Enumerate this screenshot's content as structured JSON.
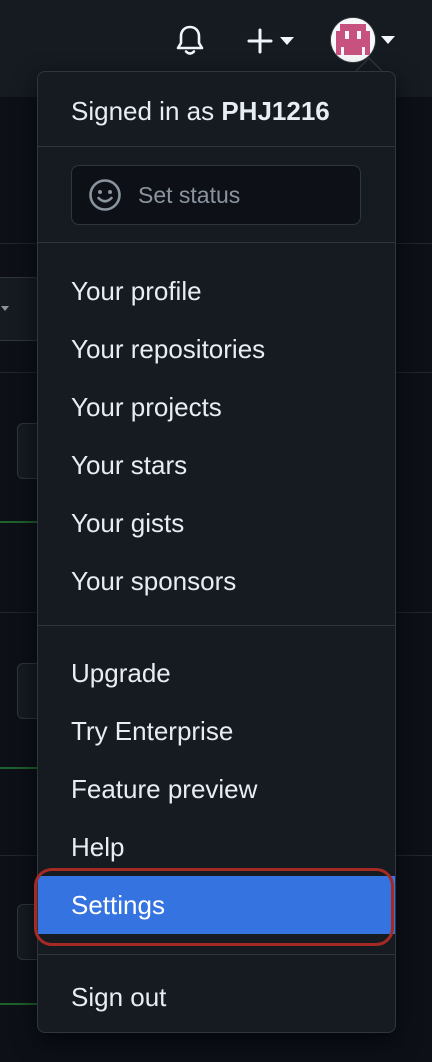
{
  "header": {
    "notifications_icon": "bell-icon",
    "create_icon": "plus-icon",
    "caret_icon": "caret-down-icon",
    "avatar_icon": "user-avatar"
  },
  "menu": {
    "signed_in_prefix": "Signed in as",
    "username": "PHJ1216",
    "status": {
      "icon": "smiley-icon",
      "placeholder": "Set status"
    },
    "group1": [
      {
        "label": "Your profile"
      },
      {
        "label": "Your repositories"
      },
      {
        "label": "Your projects"
      },
      {
        "label": "Your stars"
      },
      {
        "label": "Your gists"
      },
      {
        "label": "Your sponsors"
      }
    ],
    "group2": [
      {
        "label": "Upgrade"
      },
      {
        "label": "Try Enterprise"
      },
      {
        "label": "Feature preview"
      },
      {
        "label": "Help"
      },
      {
        "label": "Settings",
        "highlighted": true
      }
    ],
    "sign_out": "Sign out"
  },
  "colors": {
    "background": "#0d1117",
    "header": "#161b22",
    "menu_bg": "#161b22",
    "border": "#30363d",
    "text": "#e6edf3",
    "muted": "#8b949e",
    "active_bg": "#3574e0",
    "annotation_ring": "#a62a24"
  }
}
